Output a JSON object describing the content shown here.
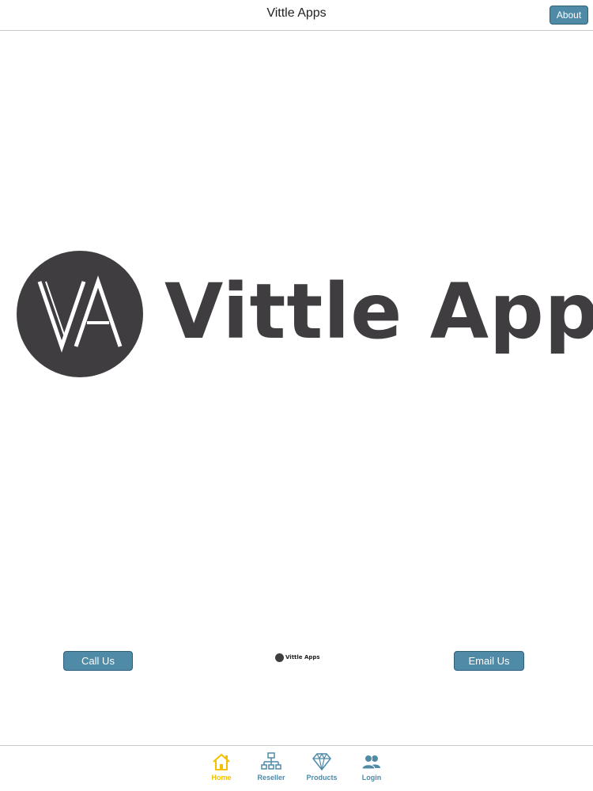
{
  "header": {
    "title": "Vittle Apps",
    "about_label": "About"
  },
  "logo": {
    "monogram": "VA",
    "wordmark": "Vittle Apps"
  },
  "actions": {
    "call_label": "Call Us",
    "email_label": "Email Us",
    "mini_logo_text": "Vittle Apps"
  },
  "tabs": [
    {
      "label": "Home",
      "icon": "home-icon",
      "active": true
    },
    {
      "label": "Reseller",
      "icon": "network-icon",
      "active": false
    },
    {
      "label": "Products",
      "icon": "diamond-icon",
      "active": false
    },
    {
      "label": "Login",
      "icon": "users-icon",
      "active": false
    }
  ],
  "colors": {
    "button_bg": "#4f8aa7",
    "active_tab": "#f2c200",
    "inactive_tab": "#4f8aa7",
    "logo_dark": "#3f3d40"
  }
}
